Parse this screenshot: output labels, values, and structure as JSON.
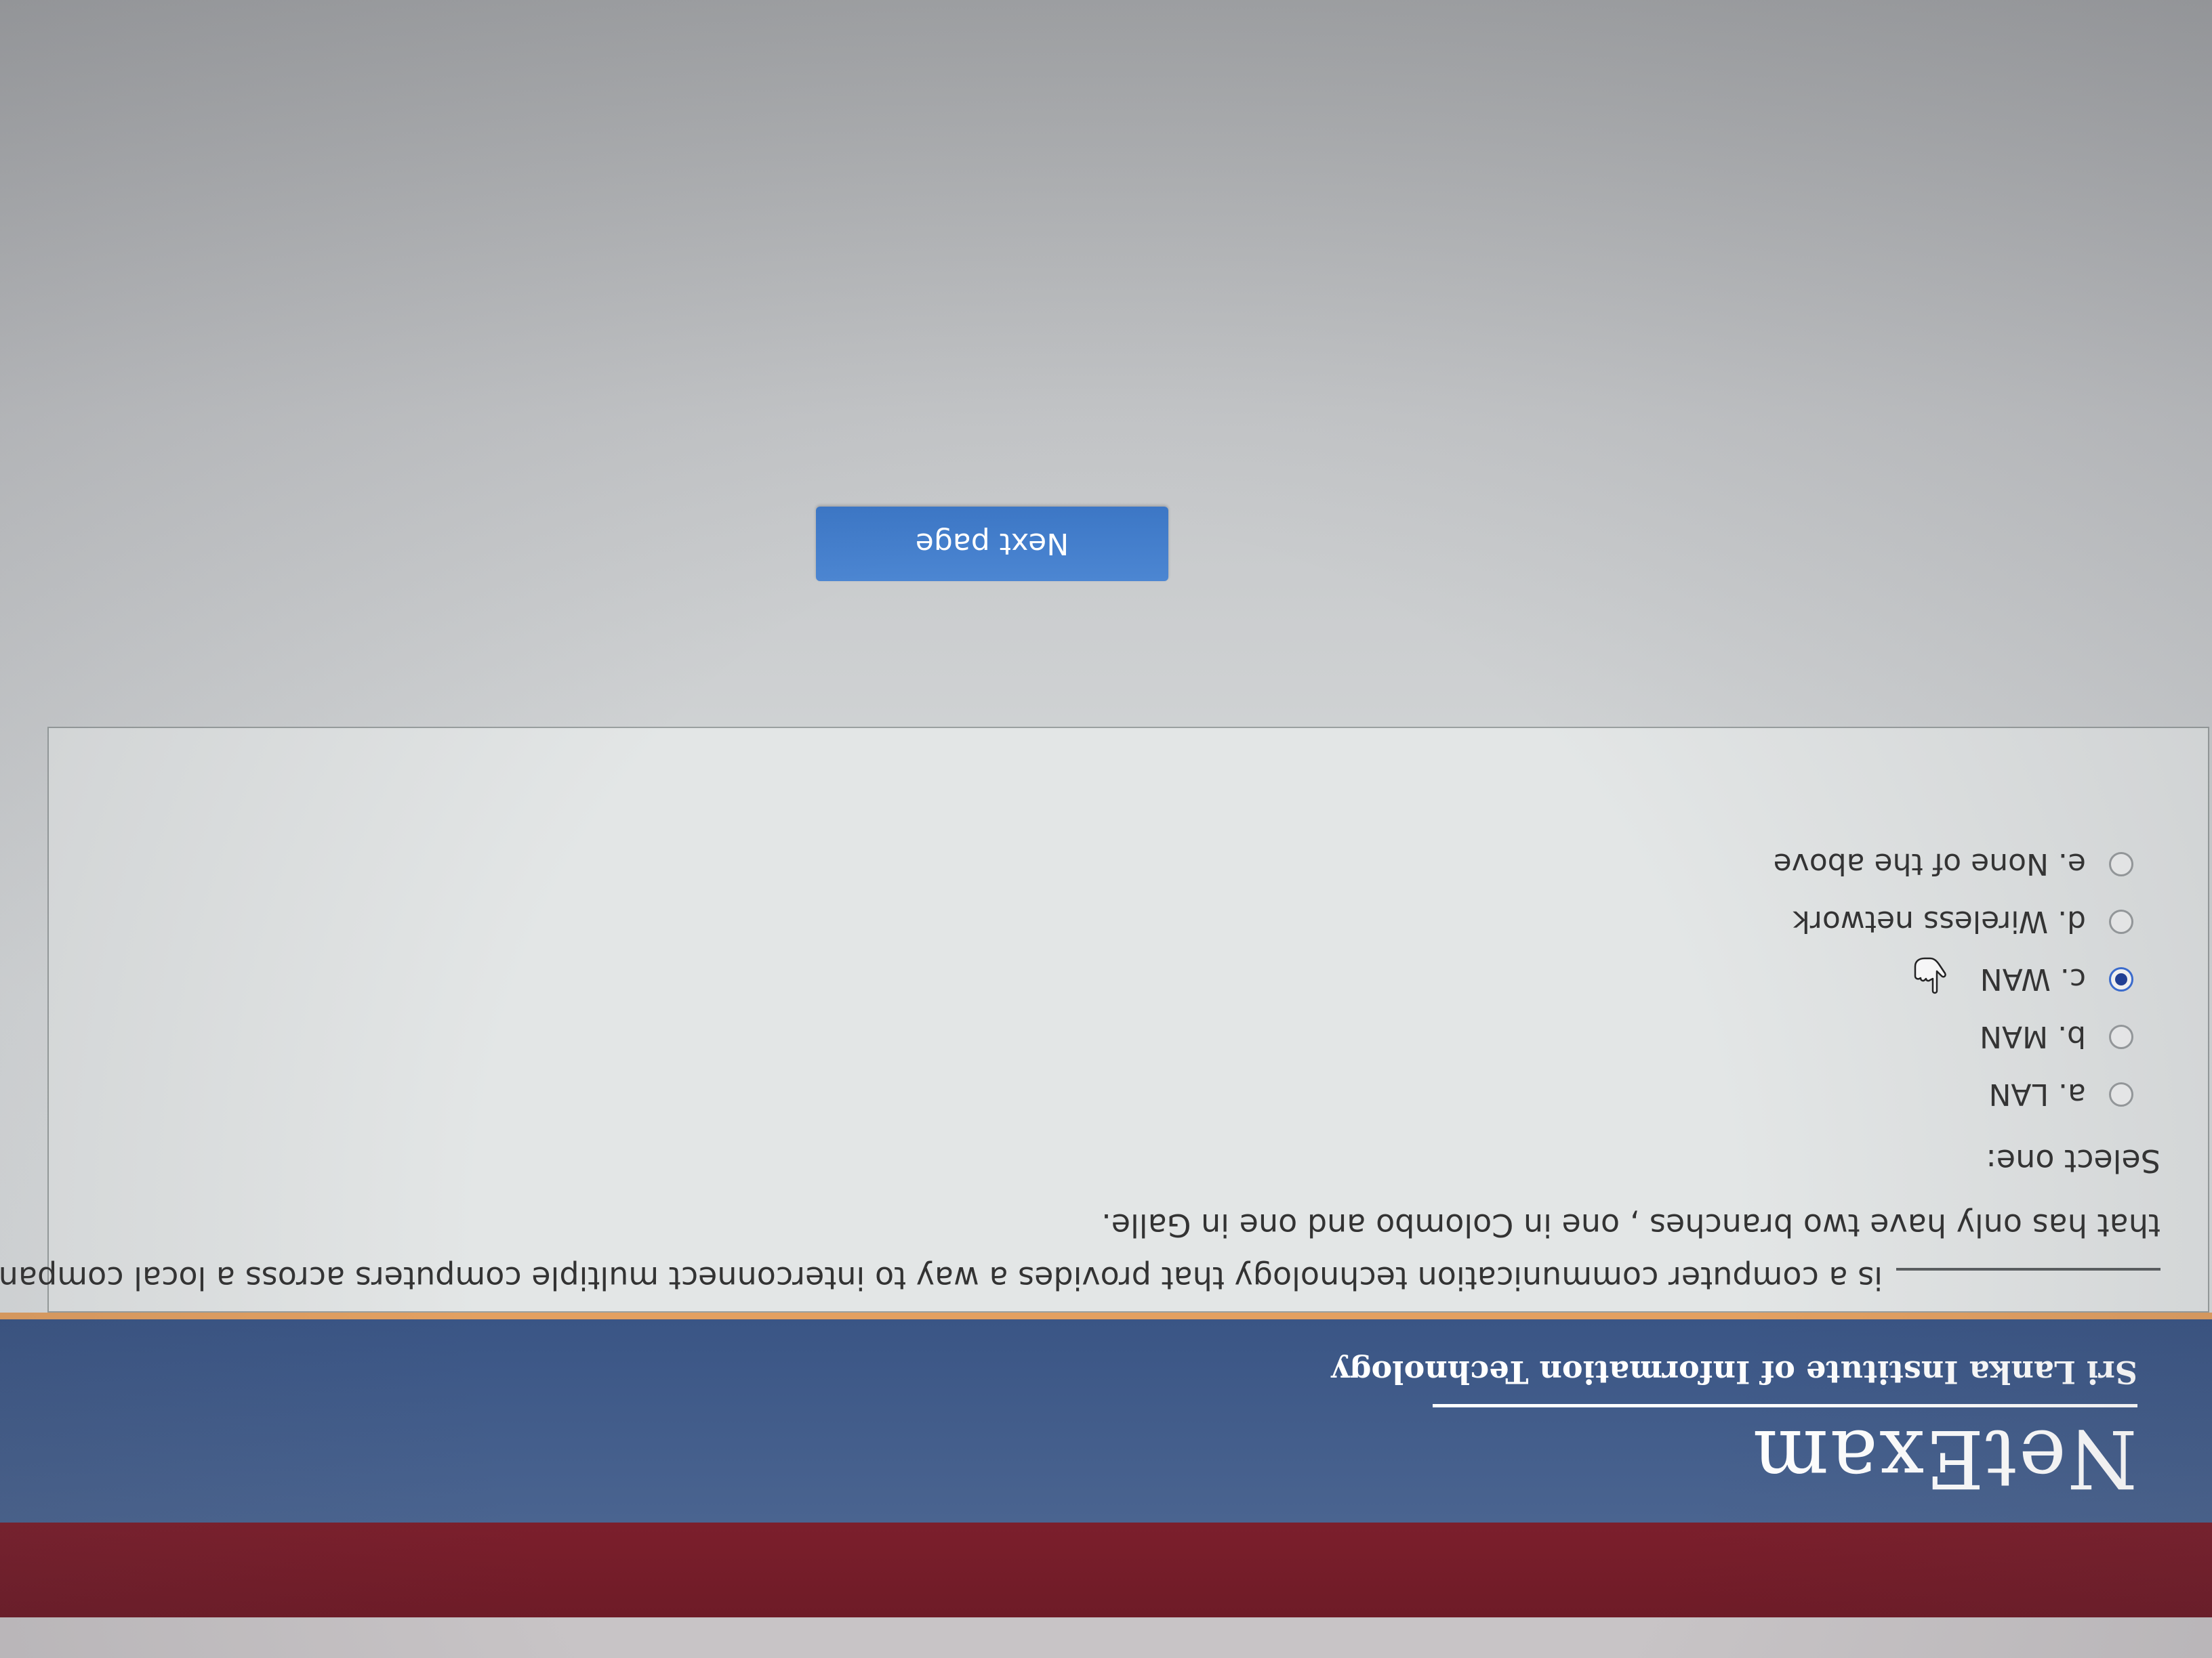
{
  "header": {
    "logo_text": "NetExam",
    "institute": "Sri Lanka Institute of Information Technology"
  },
  "question": {
    "line1": "is a computer communication technology that provides a way to interconnect multiple computers across  a local company",
    "line2": "that has only have two branches , one in Colombo and one in Galle.",
    "prompt": "Select one:",
    "options": [
      {
        "label": "a. LAN",
        "selected": false
      },
      {
        "label": "b. MAN",
        "selected": false
      },
      {
        "label": "c. WAN",
        "selected": true
      },
      {
        "label": "d. Wireless network",
        "selected": false
      },
      {
        "label": "e. None of the above",
        "selected": false
      }
    ]
  },
  "navigation": {
    "next_label": "Next page"
  },
  "colors": {
    "header_bg": "#3f5a88",
    "accent_line": "#e3a061",
    "browser_band": "#751d2a",
    "button_bg": "#4580cc",
    "radio_selected": "#1f3f9a"
  },
  "icons": {
    "cursor": "hand-pointer-icon"
  }
}
